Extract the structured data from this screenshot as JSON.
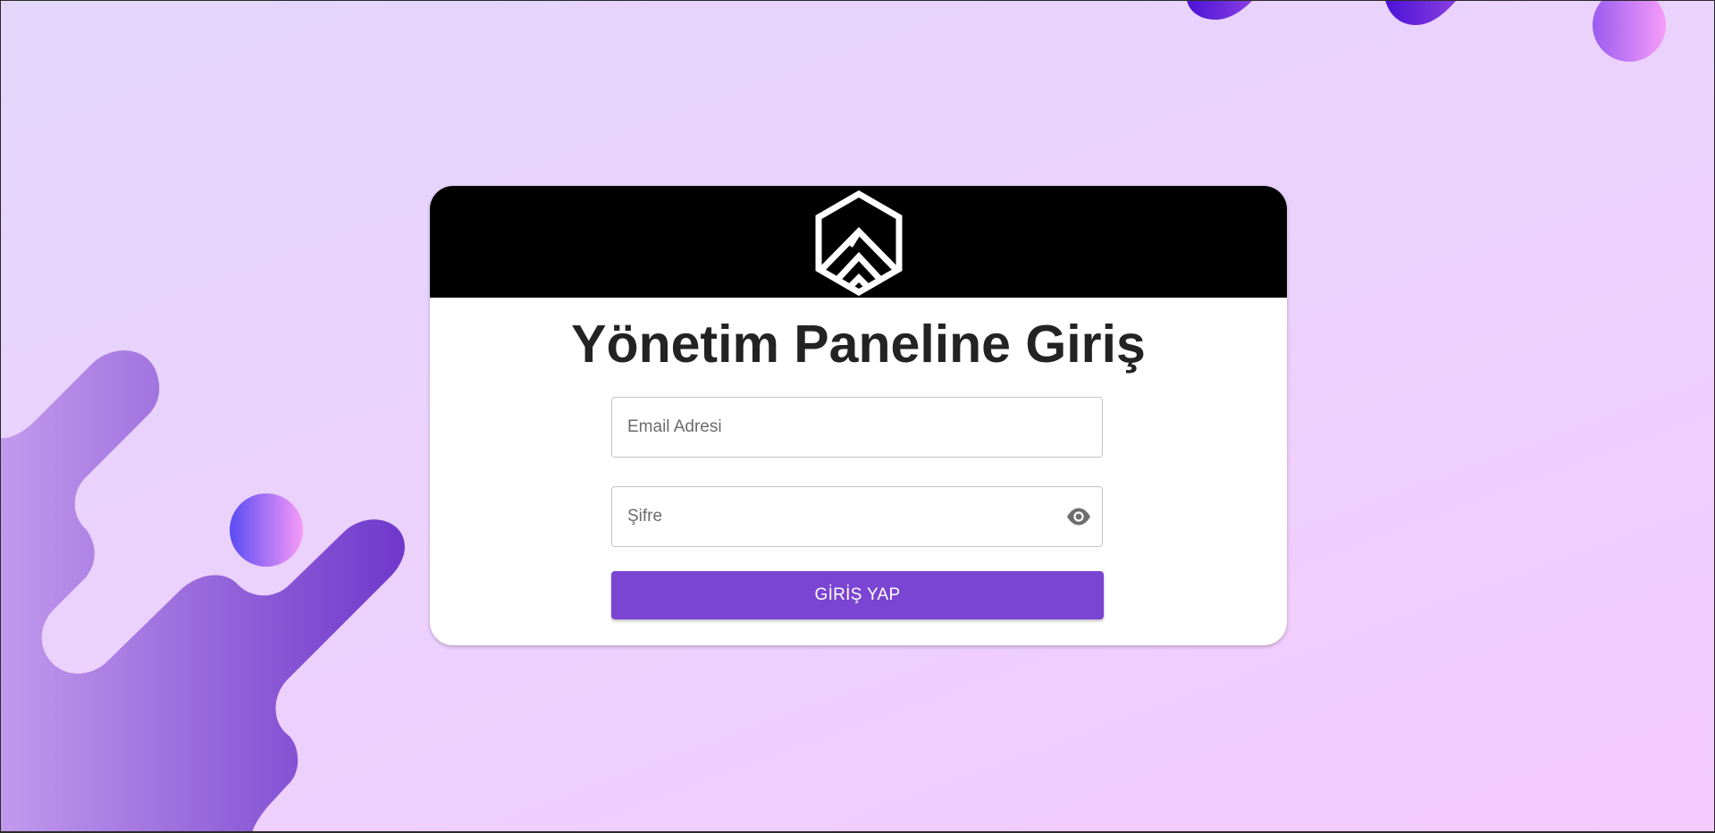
{
  "login": {
    "title": "Yönetim Paneline Giriş",
    "email_placeholder": "Email Adresi",
    "password_placeholder": "Şifre",
    "submit_label": "GİRİŞ YAP"
  },
  "icons": {
    "logo": "hexagon-shield-logo",
    "password_toggle": "eye-icon"
  },
  "colors": {
    "accent": "#7b45d3",
    "header_background": "#000000",
    "page_gradient_start": "#e3d6fb",
    "page_gradient_end": "#f4cafd",
    "blob_dark": "#6a35c9",
    "blob_light": "#c396ea"
  }
}
